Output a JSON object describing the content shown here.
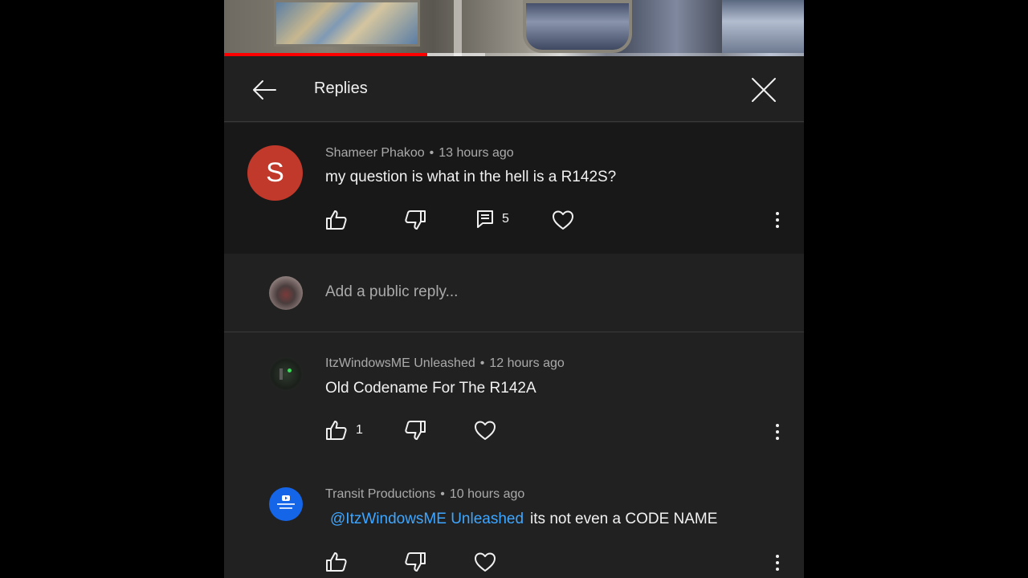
{
  "header": {
    "title": "Replies"
  },
  "video": {
    "progress_played": 0.35,
    "progress_buffered": 0.45
  },
  "parent_comment": {
    "author": "Shameer Phakoo",
    "time": "13 hours ago",
    "text": "my question is what in the hell is a R142S?",
    "avatar_letter": "S",
    "avatar_color": "#c0392b",
    "reply_count": "5"
  },
  "reply_box": {
    "placeholder": "Add a public reply..."
  },
  "replies": [
    {
      "author": "ItzWindowsME Unleashed",
      "time": "12 hours ago",
      "mention": "",
      "text": "Old Codename For The R142A",
      "like_count": "1"
    },
    {
      "author": "Transit Productions",
      "time": "10 hours ago",
      "mention": "@ItzWindowsME Unleashed",
      "text": "its not even a CODE NAME",
      "like_count": ""
    }
  ],
  "colors": {
    "background": "#212121",
    "parent_background": "#181818",
    "mention": "#3ea6ff",
    "progress": "#ff0000"
  }
}
